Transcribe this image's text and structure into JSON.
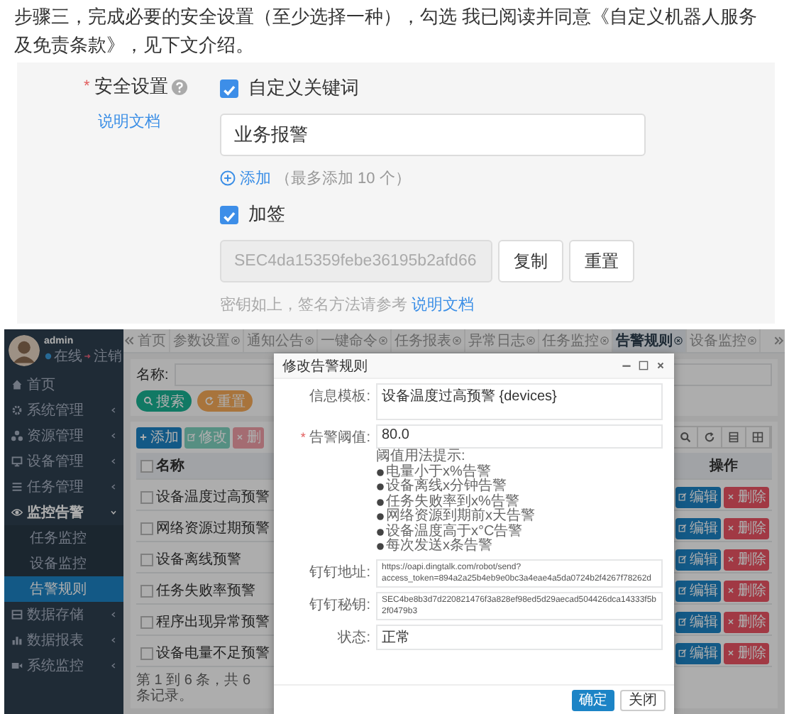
{
  "intro": {
    "text": "步骤三，完成必要的安全设置（至少选择一种），勾选 我已阅读并同意《自定义机器人服务及免责条款》，见下文介绍。"
  },
  "security_form": {
    "required_mark": "*",
    "label": "安全设置",
    "help_link": "说明文档",
    "keyword": {
      "label": "自定义关键词",
      "checked": true,
      "value": "业务报警"
    },
    "add": {
      "link": "添加",
      "note": "（最多添加 10 个）"
    },
    "sign": {
      "label": "加签",
      "checked": true,
      "value": "SEC4da15359febe36195b2afd66",
      "disabled": true
    },
    "buttons": [
      "复制",
      "重置"
    ],
    "hint": {
      "text": "密钥如上，签名方法请参考",
      "link": "说明文档"
    }
  },
  "admin_app": {
    "user": {
      "name": "admin",
      "status": "在线",
      "logout": "注销"
    },
    "sidebar": [
      {
        "label": "首页",
        "selected": false
      },
      {
        "label": "系统管理",
        "selected": false,
        "expanded": false
      },
      {
        "label": "资源管理",
        "selected": false,
        "expanded": false
      },
      {
        "label": "设备管理",
        "selected": false,
        "expanded": false
      },
      {
        "label": "任务管理",
        "selected": false,
        "expanded": false
      },
      {
        "label": "监控告警",
        "selected": false,
        "expanded": true,
        "children": [
          {
            "label": "任务监控",
            "selected": false
          },
          {
            "label": "设备监控",
            "selected": false
          },
          {
            "label": "告警规则",
            "selected": true
          }
        ]
      },
      {
        "label": "数据存储",
        "selected": false,
        "expanded": false
      },
      {
        "label": "数据报表",
        "selected": false,
        "expanded": false
      },
      {
        "label": "系统监控",
        "selected": false,
        "expanded": false
      }
    ],
    "tabs": [
      {
        "label": "首页",
        "selected": false,
        "closable": false
      },
      {
        "label": "参数设置",
        "selected": false,
        "closable": true
      },
      {
        "label": "通知公告",
        "selected": false,
        "closable": true
      },
      {
        "label": "一键命令",
        "selected": false,
        "closable": true
      },
      {
        "label": "任务报表",
        "selected": false,
        "closable": true
      },
      {
        "label": "异常日志",
        "selected": false,
        "closable": true
      },
      {
        "label": "任务监控",
        "selected": false,
        "closable": true
      },
      {
        "label": "告警规则",
        "selected": true,
        "closable": true
      },
      {
        "label": "设备监控",
        "selected": false,
        "closable": true
      }
    ],
    "search": {
      "label": "名称:",
      "buttons": [
        "搜索",
        "重置"
      ]
    },
    "toolbar": [
      "添加",
      "修改",
      "删"
    ],
    "table": {
      "columns": [
        "名称",
        "操作"
      ],
      "header_checked": false,
      "rows": [
        {
          "name": "设备温度过高预警",
          "checked": false,
          "actions": [
            "编辑",
            "删除"
          ]
        },
        {
          "name": "网络资源过期预警",
          "checked": false,
          "actions": [
            "编辑",
            "删除"
          ]
        },
        {
          "name": "设备离线预警",
          "checked": false,
          "actions": [
            "编辑",
            "删除"
          ]
        },
        {
          "name": "任务失败率预警",
          "checked": false,
          "actions": [
            "编辑",
            "删除"
          ]
        },
        {
          "name": "程序出现异常预警",
          "checked": false,
          "actions": [
            "编辑",
            "删除"
          ]
        },
        {
          "name": "设备电量不足预警",
          "checked": false,
          "actions": [
            "编辑",
            "删除"
          ]
        }
      ]
    },
    "pagination": "第 1 到 6 条，共 6 条记录。",
    "modal": {
      "title": "修改告警规则",
      "fields": [
        {
          "kind": "textarea",
          "label": "信息模板:",
          "value": "设备温度过高预警 {devices}"
        },
        {
          "kind": "input",
          "label": "告警阈值:",
          "required_mark": "*",
          "value": "80.0",
          "hint_title": "阈值用法提示:",
          "hints": [
            "电量小于x%告警",
            "设备离线x分钟告警",
            "任务失败率到x%告警",
            "网络资源到期前x天告警",
            "设备温度高于x°C告警",
            "每次发送x条告警"
          ]
        },
        {
          "kind": "token",
          "label": "钉钉地址:",
          "value": "https://oapi.dingtalk.com/robot/send?access_token=894a2a25b4eb9e0bc3a4eae4a5da0724b2f4267f78262d"
        },
        {
          "kind": "token",
          "label": "钉钉秘钥:",
          "value": "SEC4be8b3d7d220821476f3a828ef98ed5d29aecad504426dca14333f5b2f0479b3"
        },
        {
          "kind": "input",
          "label": "状态:",
          "value": "正常"
        }
      ],
      "buttons": [
        "确定",
        "关闭"
      ]
    }
  }
}
